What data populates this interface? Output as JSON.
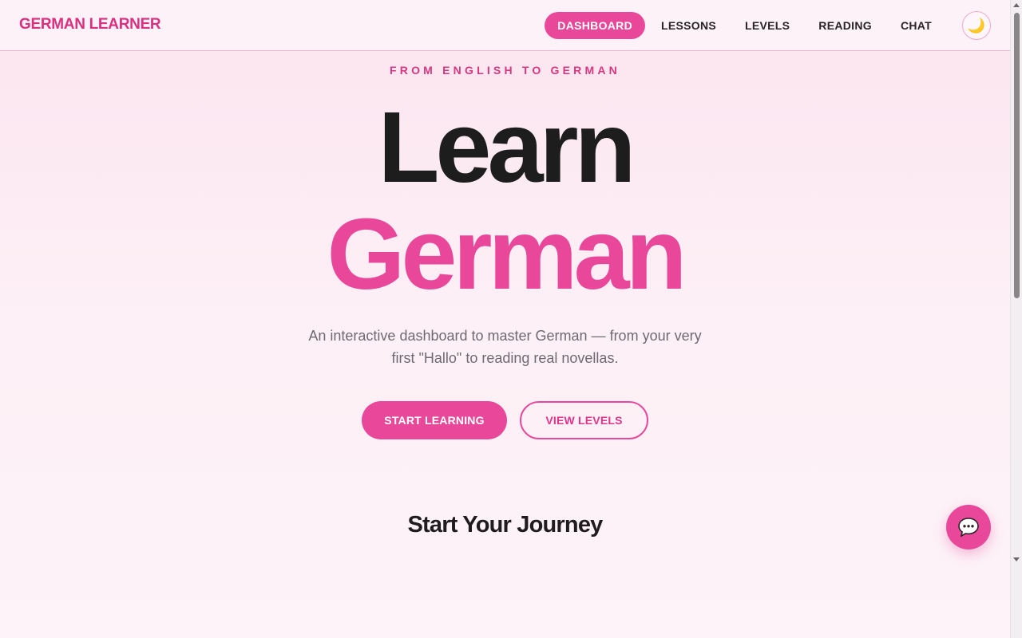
{
  "header": {
    "brand": "GERMAN LEARNER",
    "nav": [
      {
        "label": "DASHBOARD",
        "active": true
      },
      {
        "label": "LESSONS",
        "active": false
      },
      {
        "label": "LEVELS",
        "active": false
      },
      {
        "label": "READING",
        "active": false
      },
      {
        "label": "CHAT",
        "active": false
      }
    ],
    "theme_toggle_icon": "moon-icon"
  },
  "hero": {
    "eyebrow": "FROM ENGLISH TO GERMAN",
    "title_line1": "Learn",
    "title_line2": "German",
    "subtitle": "An interactive dashboard to master German — from your very first \"Hallo\" to reading real novellas.",
    "primary_cta": "START LEARNING",
    "secondary_cta": "VIEW LEVELS"
  },
  "journey": {
    "title": "Start Your Journey"
  },
  "chat_fab": {
    "icon": "chat-bubble-icon"
  },
  "colors": {
    "accent": "#e9489a",
    "brand": "#dc2f7f",
    "heading": "#1d1d1d",
    "muted": "#6f6a72"
  }
}
